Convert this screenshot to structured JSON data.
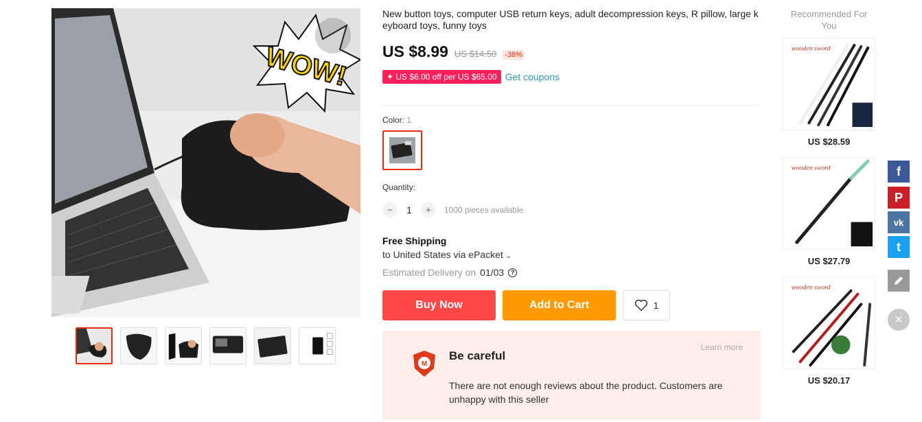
{
  "product": {
    "title": "New button toys, computer USB return keys, adult decompression keys, R pillow, large keyboard toys, funny toys",
    "price": "US $8.99",
    "old_price": "US $14.50",
    "discount": "-38%",
    "coupon": "US $6.00 off per US $65.00",
    "coupon_link": "Get coupons",
    "wow_text": "WOW!"
  },
  "color": {
    "label": "Color:",
    "value": "1"
  },
  "quantity": {
    "label": "Quantity:",
    "minus": "−",
    "plus": "+",
    "value": "1",
    "available": "1000 pieces available"
  },
  "shipping": {
    "title": "Free Shipping",
    "to": "to United States via ePacket",
    "delivery_label": "Estimated Delivery on",
    "delivery_date": "01/03"
  },
  "actions": {
    "buy_now": "Buy Now",
    "add_to_cart": "Add to Cart",
    "wishlist_count": "1"
  },
  "warning": {
    "title": "Be careful",
    "learn_more": "Learn more",
    "text": "There are not enough reviews about the product. Customers are unhappy with this seller"
  },
  "recommended": {
    "title": "Recommended For You",
    "items": [
      {
        "label": "wooden sword",
        "price": "US $28.59"
      },
      {
        "label": "wooden sword",
        "price": "US $27.79"
      },
      {
        "label": "wooden sword",
        "price": "US $20.17"
      }
    ]
  },
  "share": {
    "facebook": "f",
    "pinterest": "P",
    "vk": "vk",
    "twitter": "t"
  },
  "colors": {
    "primary": "#ff4747",
    "cart": "#ff9a05",
    "coupon": "#ff1f5a",
    "link": "#2e9cc3"
  }
}
